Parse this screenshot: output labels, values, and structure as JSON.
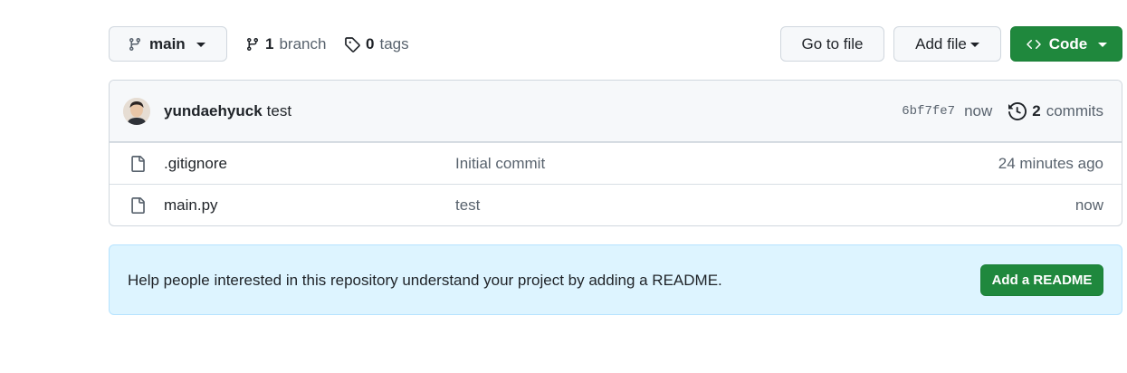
{
  "toolbar": {
    "branch_name": "main",
    "branch_count": "1",
    "branch_label": "branch",
    "tag_count": "0",
    "tag_label": "tags",
    "go_to_file": "Go to file",
    "add_file": "Add file",
    "code": "Code"
  },
  "latest_commit": {
    "author": "yundaehyuck",
    "message": "test",
    "sha": "6bf7fe7",
    "time": "now",
    "commit_count": "2",
    "commit_label": "commits"
  },
  "files": [
    {
      "name": ".gitignore",
      "message": "Initial commit",
      "age": "24 minutes ago"
    },
    {
      "name": "main.py",
      "message": "test",
      "age": "now"
    }
  ],
  "readme_banner": {
    "text": "Help people interested in this repository understand your project by adding a README.",
    "button": "Add a README"
  },
  "colors": {
    "primary_green": "#1f883d",
    "banner_bg": "#ddf4ff",
    "muted_text": "#59636e",
    "border": "#d0d7de"
  },
  "icons": [
    "git-branch-icon",
    "tag-icon",
    "code-icon",
    "history-icon",
    "file-icon"
  ]
}
